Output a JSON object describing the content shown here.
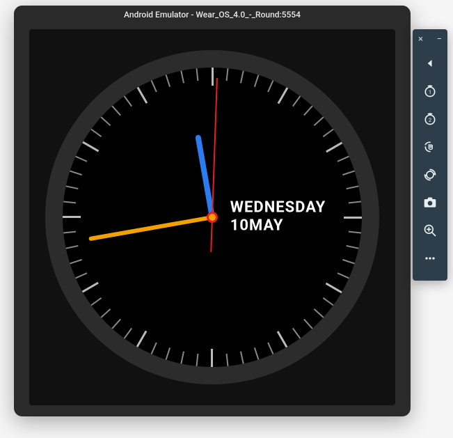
{
  "window": {
    "title": "Android Emulator - Wear_OS_4.0_-_Round:5554"
  },
  "watch": {
    "day": "WEDNESDAY",
    "date": "10MAY",
    "hands": {
      "hour_angle": 350,
      "minute_angle": 260,
      "second_angle": 2
    },
    "colors": {
      "hour_hand": "#2a7cf0",
      "minute_hand": "#f1a200",
      "second_hand": "#e62020",
      "bezel": "#3a3a3a",
      "face": "#000000"
    }
  },
  "toolbar": {
    "close_label": "×",
    "minimize_label": "−",
    "buttons": [
      {
        "name": "back",
        "title": "Back"
      },
      {
        "name": "button1",
        "title": "Button 1"
      },
      {
        "name": "button2",
        "title": "Button 2"
      },
      {
        "name": "palm",
        "title": "Palm"
      },
      {
        "name": "tilt",
        "title": "Tilt"
      },
      {
        "name": "camera",
        "title": "Take screenshot"
      },
      {
        "name": "zoom",
        "title": "Zoom"
      },
      {
        "name": "more",
        "title": "More"
      }
    ]
  }
}
